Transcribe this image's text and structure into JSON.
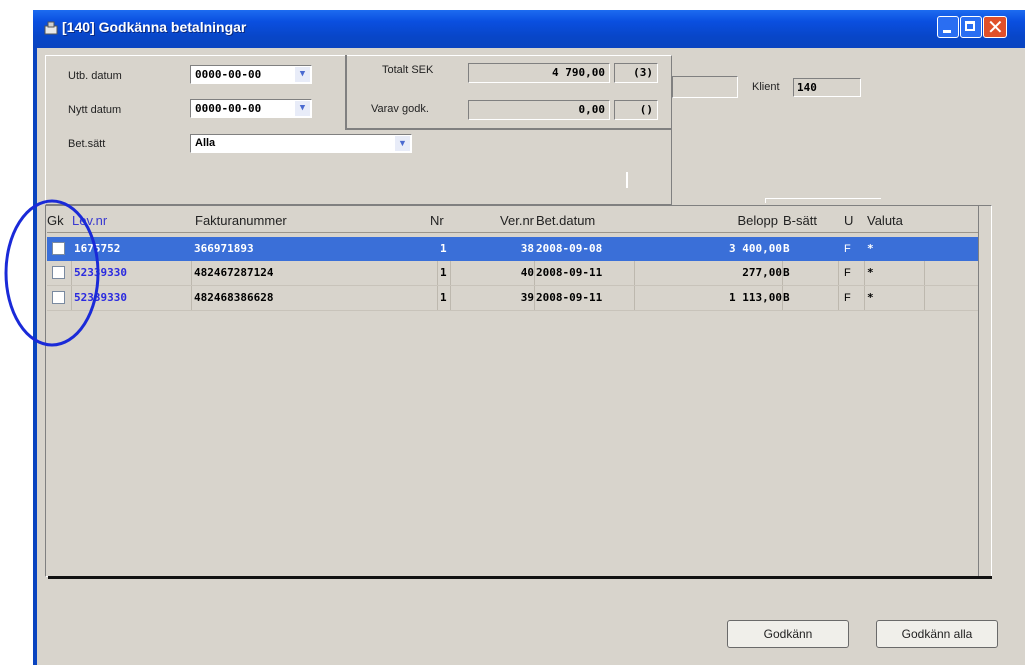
{
  "window": {
    "title": "[140]  Godkänna betalningar"
  },
  "filters": {
    "utb_label": "Utb. datum",
    "utb_value": "0000-00-00",
    "nytt_label": "Nytt datum",
    "nytt_value": "0000-00-00",
    "betsatt_label": "Bet.sätt",
    "betsatt_value": "Alla"
  },
  "totals": {
    "totalt_label": "Totalt SEK",
    "totalt_value": "4 790,00",
    "totalt_count": "(3)",
    "varav_label": "Varav godk.",
    "varav_value": "0,00",
    "varav_count": "()"
  },
  "klient": {
    "label": "Klient",
    "value": "140"
  },
  "table": {
    "headers": {
      "gk": "Gk",
      "levnr": "Lev.nr",
      "faktura": "Fakturanummer",
      "nr": "Nr",
      "vernr": "Ver.nr",
      "betdatum": "Bet.datum",
      "belopp": "Belopp",
      "bsatt": "B-sätt",
      "u": "U",
      "valuta": "Valuta"
    },
    "rows": [
      {
        "levnr": "1675752",
        "faktura": "366971893",
        "nr": "1",
        "vernr": "38",
        "betdatum": "2008-09-08",
        "belopp": "3 400,00",
        "bsatt": "B",
        "u": "F",
        "valuta": "*",
        "selected": true
      },
      {
        "levnr": "52339330",
        "faktura": "482467287124",
        "nr": "1",
        "vernr": "40",
        "betdatum": "2008-09-11",
        "belopp": "277,00",
        "bsatt": "B",
        "u": "F",
        "valuta": "*"
      },
      {
        "levnr": "52339330",
        "faktura": "482468386628",
        "nr": "1",
        "vernr": "39",
        "betdatum": "2008-09-11",
        "belopp": "1 113,00",
        "bsatt": "B",
        "u": "F",
        "valuta": "*"
      }
    ]
  },
  "buttons": {
    "godkann": "Godkänn",
    "godkann_alla": "Godkänn alla"
  },
  "colors": {
    "title_bar": "#0a4fe0",
    "selected_row": "#3a6fd8",
    "lev_link": "#2a2ae0",
    "annotation_circle": "#1a2ad8"
  }
}
